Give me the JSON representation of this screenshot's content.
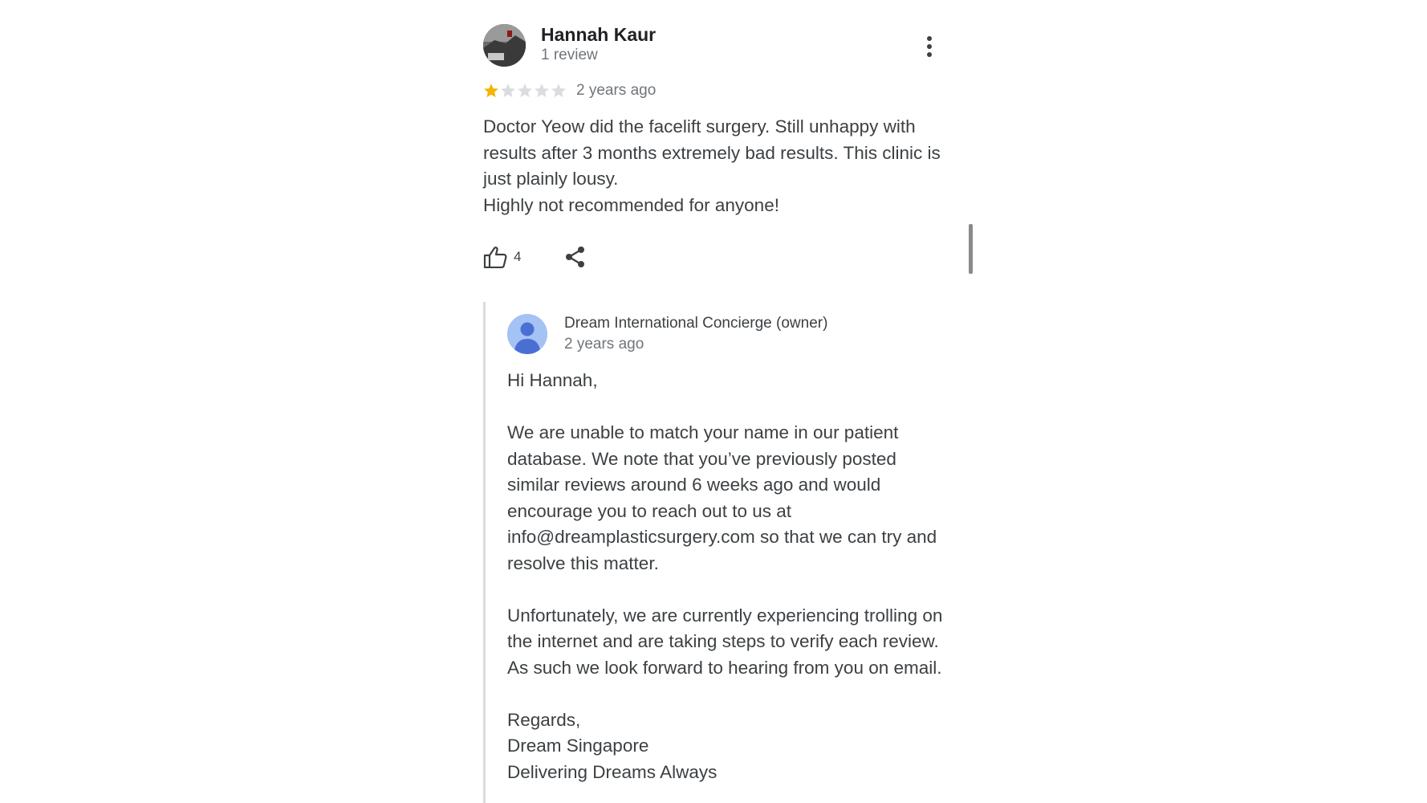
{
  "review": {
    "reviewer_name": "Hannah Kaur",
    "reviewer_meta": "1 review",
    "rating": 1,
    "rating_max": 5,
    "date": "2 years ago",
    "text_lines": [
      "Doctor Yeow did the facelift surgery. Still unhappy with results after 3 months extremely bad results. This clinic is just plainly lousy.",
      "Highly not recommended for anyone!"
    ],
    "like_count": "4",
    "colors": {
      "star_filled": "#f4b400",
      "star_empty": "#dadce0"
    }
  },
  "owner_reply": {
    "name": "Dream International Concierge (owner)",
    "date": "2 years ago",
    "greeting": "Hi Hannah,",
    "paragraph_1": "We are unable to match your name in our patient database. We note that you’ve previously posted similar reviews around 6 weeks ago and would encourage you to reach out to us at info@dreamplasticsurgery.com so that we can try and resolve this matter.",
    "paragraph_2": "Unfortunately, we are currently experiencing trolling on the internet and are taking steps to verify each review. As such we look forward to hearing from you on email.",
    "signoff_1": "Regards,",
    "signoff_2": "Dream Singapore",
    "signoff_3": "Delivering Dreams Always",
    "avatar_color": "#a4c2f4",
    "avatar_figure_color": "#4a6fd4"
  },
  "icons": {
    "more": "more-vert-icon",
    "like": "thumbs-up-icon",
    "share": "share-icon"
  }
}
